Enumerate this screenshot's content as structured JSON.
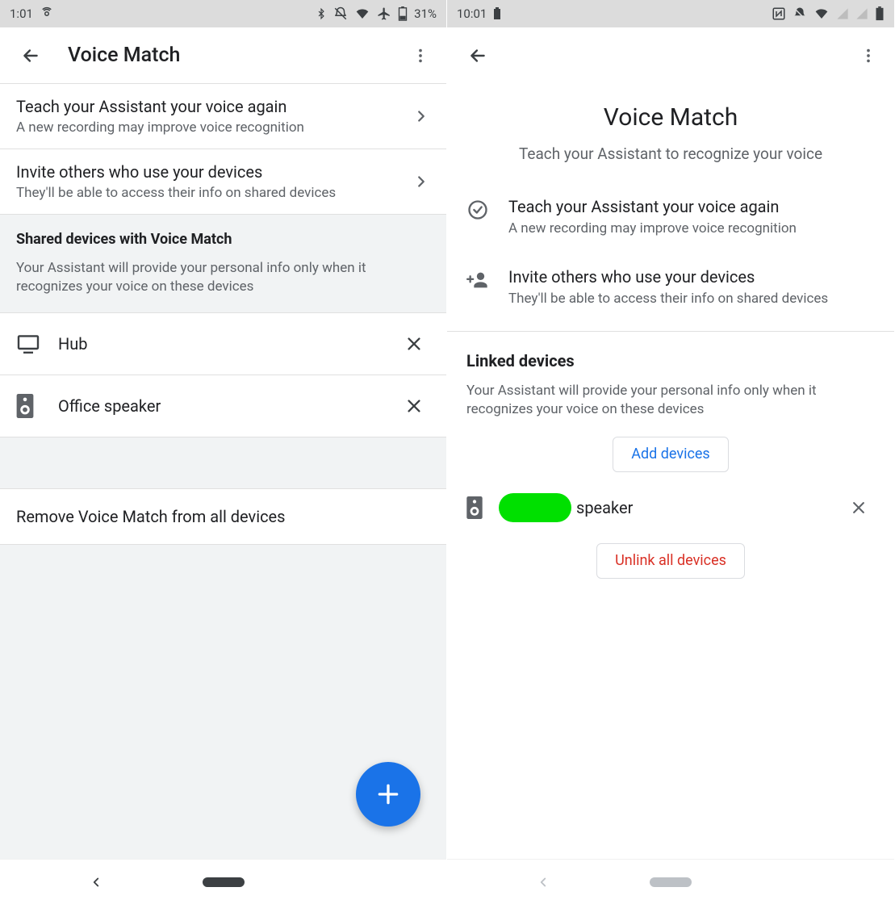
{
  "left": {
    "status": {
      "time": "1:01",
      "battery": "31%"
    },
    "app_title": "Voice Match",
    "teach": {
      "title": "Teach your Assistant your voice again",
      "sub": "A new recording may improve voice recognition"
    },
    "invite": {
      "title": "Invite others who use your devices",
      "sub": "They'll be able to access their info on shared devices"
    },
    "shared_section": {
      "title": "Shared devices with Voice Match",
      "desc": "Your Assistant will provide your personal info only when it recognizes your voice on these devices"
    },
    "devices": [
      {
        "name": "Hub",
        "kind": "display"
      },
      {
        "name": "Office speaker",
        "kind": "speaker"
      }
    ],
    "remove_all": "Remove Voice Match from all devices"
  },
  "right": {
    "status": {
      "time": "10:01"
    },
    "page_title": "Voice Match",
    "subtitle": "Teach your Assistant to recognize your voice",
    "teach": {
      "title": "Teach your Assistant your voice again",
      "sub": "A new recording may improve voice recognition"
    },
    "invite": {
      "title": "Invite others who use your devices",
      "sub": "They'll be able to access their info on shared devices"
    },
    "linked": {
      "title": "Linked devices",
      "desc": "Your Assistant will provide your personal info only when it recognizes your voice on these devices"
    },
    "add_button": "Add devices",
    "device": {
      "name_suffix": "speaker"
    },
    "unlink_button": "Unlink all devices"
  }
}
